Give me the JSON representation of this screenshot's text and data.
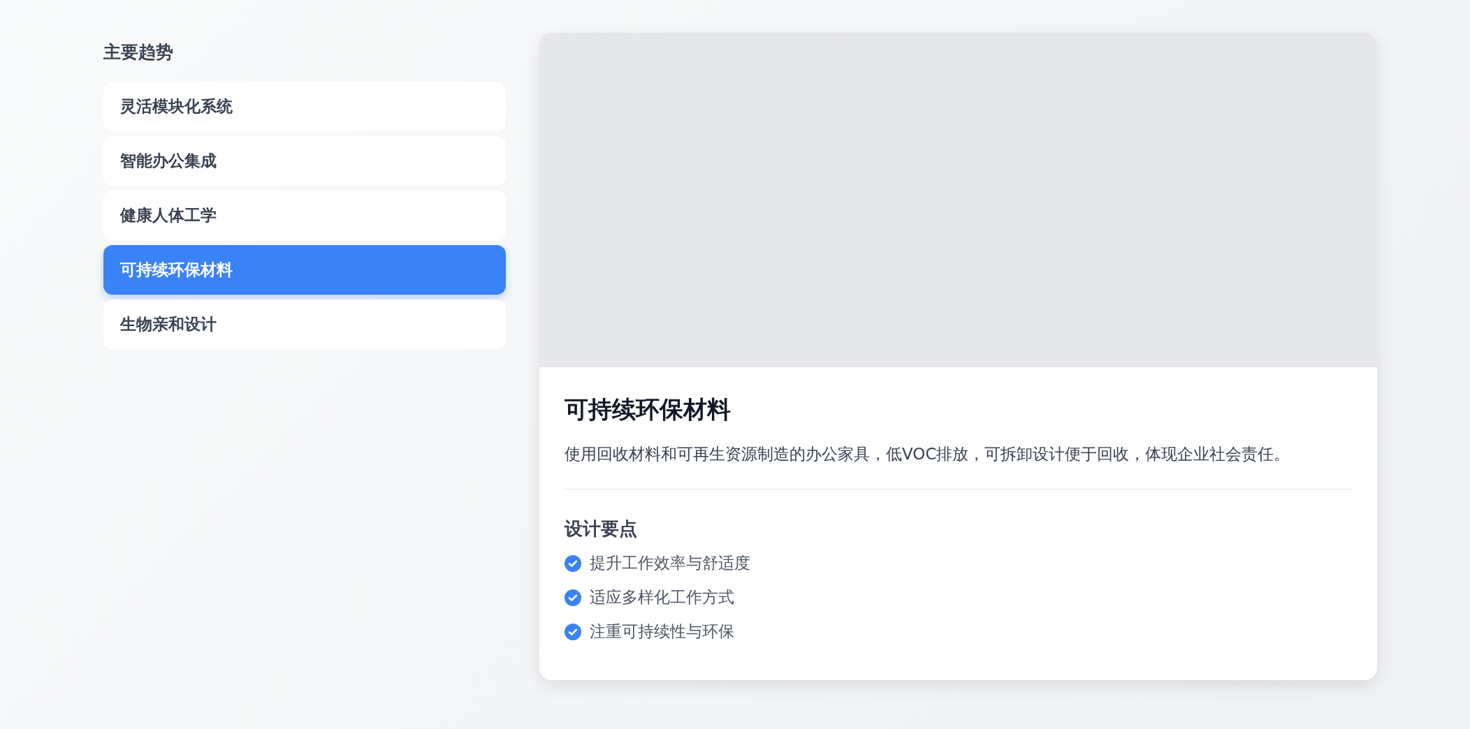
{
  "sidebar": {
    "title": "主要趋势",
    "items": [
      {
        "label": "灵活模块化系统",
        "selected": false
      },
      {
        "label": "智能办公集成",
        "selected": false
      },
      {
        "label": "健康人体工学",
        "selected": false
      },
      {
        "label": "可持续环保材料",
        "selected": true
      },
      {
        "label": "生物亲和设计",
        "selected": false
      }
    ]
  },
  "detail": {
    "title": "可持续环保材料",
    "description": "使用回收材料和可再生资源制造的办公家具，低VOC排放，可拆卸设计便于回收，体现企业社会责任。",
    "points_title": "设计要点",
    "points": [
      "提升工作效率与舒适度",
      "适应多样化工作方式",
      "注重可持续性与环保"
    ]
  }
}
